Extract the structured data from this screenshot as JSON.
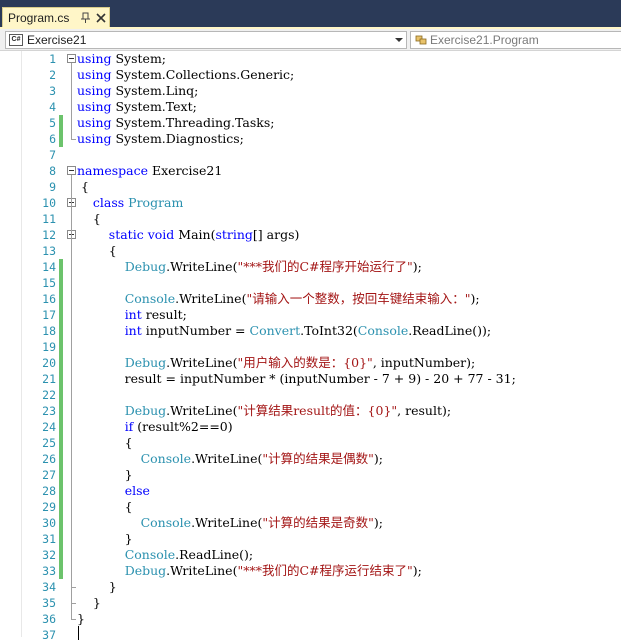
{
  "tab": {
    "title": "Program.cs",
    "pin_glyph": "pin-icon",
    "close_glyph": "close-icon"
  },
  "navbar": {
    "project_icon": "C#",
    "project": "Exercise21",
    "member": "Exercise21.Program"
  },
  "colors": {
    "keyword": "#0000ff",
    "type": "#2b91af",
    "string": "#a31515",
    "change_bar": "#6cc36c",
    "line_number": "#2b91af"
  },
  "lines": [
    {
      "n": "1",
      "tokens": [
        [
          "kw",
          "using"
        ],
        [
          "p",
          " System;"
        ]
      ]
    },
    {
      "n": "2",
      "tokens": [
        [
          "kw",
          "using"
        ],
        [
          "p",
          " System.Collections.Generic;"
        ]
      ]
    },
    {
      "n": "3",
      "tokens": [
        [
          "kw",
          "using"
        ],
        [
          "p",
          " System.Linq;"
        ]
      ]
    },
    {
      "n": "4",
      "tokens": [
        [
          "kw",
          "using"
        ],
        [
          "p",
          " System.Text;"
        ]
      ]
    },
    {
      "n": "5",
      "tokens": [
        [
          "kw",
          "using"
        ],
        [
          "p",
          " System.Threading.Tasks;"
        ]
      ]
    },
    {
      "n": "6",
      "tokens": [
        [
          "kw",
          "using"
        ],
        [
          "p",
          " System.Diagnostics;"
        ]
      ]
    },
    {
      "n": "7",
      "tokens": []
    },
    {
      "n": "8",
      "tokens": [
        [
          "kw",
          "namespace"
        ],
        [
          "p",
          " Exercise21"
        ]
      ]
    },
    {
      "n": "9",
      "tokens": [
        [
          "p",
          " {"
        ]
      ]
    },
    {
      "n": "10",
      "tokens": [
        [
          "p",
          "    "
        ],
        [
          "kw",
          "class"
        ],
        [
          "p",
          " "
        ],
        [
          "ty",
          "Program"
        ]
      ]
    },
    {
      "n": "11",
      "tokens": [
        [
          "p",
          "    {"
        ]
      ]
    },
    {
      "n": "12",
      "tokens": [
        [
          "p",
          "        "
        ],
        [
          "kw",
          "static"
        ],
        [
          "p",
          " "
        ],
        [
          "kw",
          "void"
        ],
        [
          "p",
          " Main("
        ],
        [
          "kw",
          "string"
        ],
        [
          "p",
          "[] args)"
        ]
      ]
    },
    {
      "n": "13",
      "tokens": [
        [
          "p",
          "        {"
        ]
      ]
    },
    {
      "n": "14",
      "tokens": [
        [
          "p",
          "            "
        ],
        [
          "ty",
          "Debug"
        ],
        [
          "p",
          ".WriteLine("
        ],
        [
          "st",
          "\"***我们的C#程序开始运行了\""
        ],
        [
          "p",
          ");"
        ]
      ]
    },
    {
      "n": "15",
      "tokens": []
    },
    {
      "n": "16",
      "tokens": [
        [
          "p",
          "            "
        ],
        [
          "ty",
          "Console"
        ],
        [
          "p",
          ".WriteLine("
        ],
        [
          "st",
          "\"请输入一个整数，按回车键结束输入：\""
        ],
        [
          "p",
          ");"
        ]
      ]
    },
    {
      "n": "17",
      "tokens": [
        [
          "p",
          "            "
        ],
        [
          "kw",
          "int"
        ],
        [
          "p",
          " result;"
        ]
      ]
    },
    {
      "n": "18",
      "tokens": [
        [
          "p",
          "            "
        ],
        [
          "kw",
          "int"
        ],
        [
          "p",
          " inputNumber = "
        ],
        [
          "ty",
          "Convert"
        ],
        [
          "p",
          ".ToInt32("
        ],
        [
          "ty",
          "Console"
        ],
        [
          "p",
          ".ReadLine());"
        ]
      ]
    },
    {
      "n": "19",
      "tokens": []
    },
    {
      "n": "20",
      "tokens": [
        [
          "p",
          "            "
        ],
        [
          "ty",
          "Debug"
        ],
        [
          "p",
          ".WriteLine("
        ],
        [
          "st",
          "\"用户输入的数是：{0}\""
        ],
        [
          "p",
          ", inputNumber);"
        ]
      ]
    },
    {
      "n": "21",
      "tokens": [
        [
          "p",
          "            result = inputNumber * (inputNumber - 7 + 9) - 20 + 77 - 31;"
        ]
      ]
    },
    {
      "n": "22",
      "tokens": []
    },
    {
      "n": "23",
      "tokens": [
        [
          "p",
          "            "
        ],
        [
          "ty",
          "Debug"
        ],
        [
          "p",
          ".WriteLine("
        ],
        [
          "st",
          "\"计算结果result的值：{0}\""
        ],
        [
          "p",
          ", result);"
        ]
      ]
    },
    {
      "n": "24",
      "tokens": [
        [
          "p",
          "            "
        ],
        [
          "kw",
          "if"
        ],
        [
          "p",
          " (result%2==0)"
        ]
      ]
    },
    {
      "n": "25",
      "tokens": [
        [
          "p",
          "            {"
        ]
      ]
    },
    {
      "n": "26",
      "tokens": [
        [
          "p",
          "                "
        ],
        [
          "ty",
          "Console"
        ],
        [
          "p",
          ".WriteLine("
        ],
        [
          "st",
          "\"计算的结果是偶数\""
        ],
        [
          "p",
          ");"
        ]
      ]
    },
    {
      "n": "27",
      "tokens": [
        [
          "p",
          "            }"
        ]
      ]
    },
    {
      "n": "28",
      "tokens": [
        [
          "p",
          "            "
        ],
        [
          "kw",
          "else"
        ]
      ]
    },
    {
      "n": "29",
      "tokens": [
        [
          "p",
          "            {"
        ]
      ]
    },
    {
      "n": "30",
      "tokens": [
        [
          "p",
          "                "
        ],
        [
          "ty",
          "Console"
        ],
        [
          "p",
          ".WriteLine("
        ],
        [
          "st",
          "\"计算的结果是奇数\""
        ],
        [
          "p",
          ");"
        ]
      ]
    },
    {
      "n": "31",
      "tokens": [
        [
          "p",
          "            }"
        ]
      ]
    },
    {
      "n": "32",
      "tokens": [
        [
          "p",
          "            "
        ],
        [
          "ty",
          "Console"
        ],
        [
          "p",
          ".ReadLine();"
        ]
      ]
    },
    {
      "n": "33",
      "tokens": [
        [
          "p",
          "            "
        ],
        [
          "ty",
          "Debug"
        ],
        [
          "p",
          ".WriteLine("
        ],
        [
          "st",
          "\"***我们的C#程序运行结束了\""
        ],
        [
          "p",
          ");"
        ]
      ]
    },
    {
      "n": "34",
      "tokens": [
        [
          "p",
          "        }"
        ]
      ]
    },
    {
      "n": "35",
      "tokens": [
        [
          "p",
          "    }"
        ]
      ]
    },
    {
      "n": "36",
      "tokens": [
        [
          "p",
          "}"
        ]
      ]
    },
    {
      "n": "37",
      "tokens": []
    }
  ]
}
